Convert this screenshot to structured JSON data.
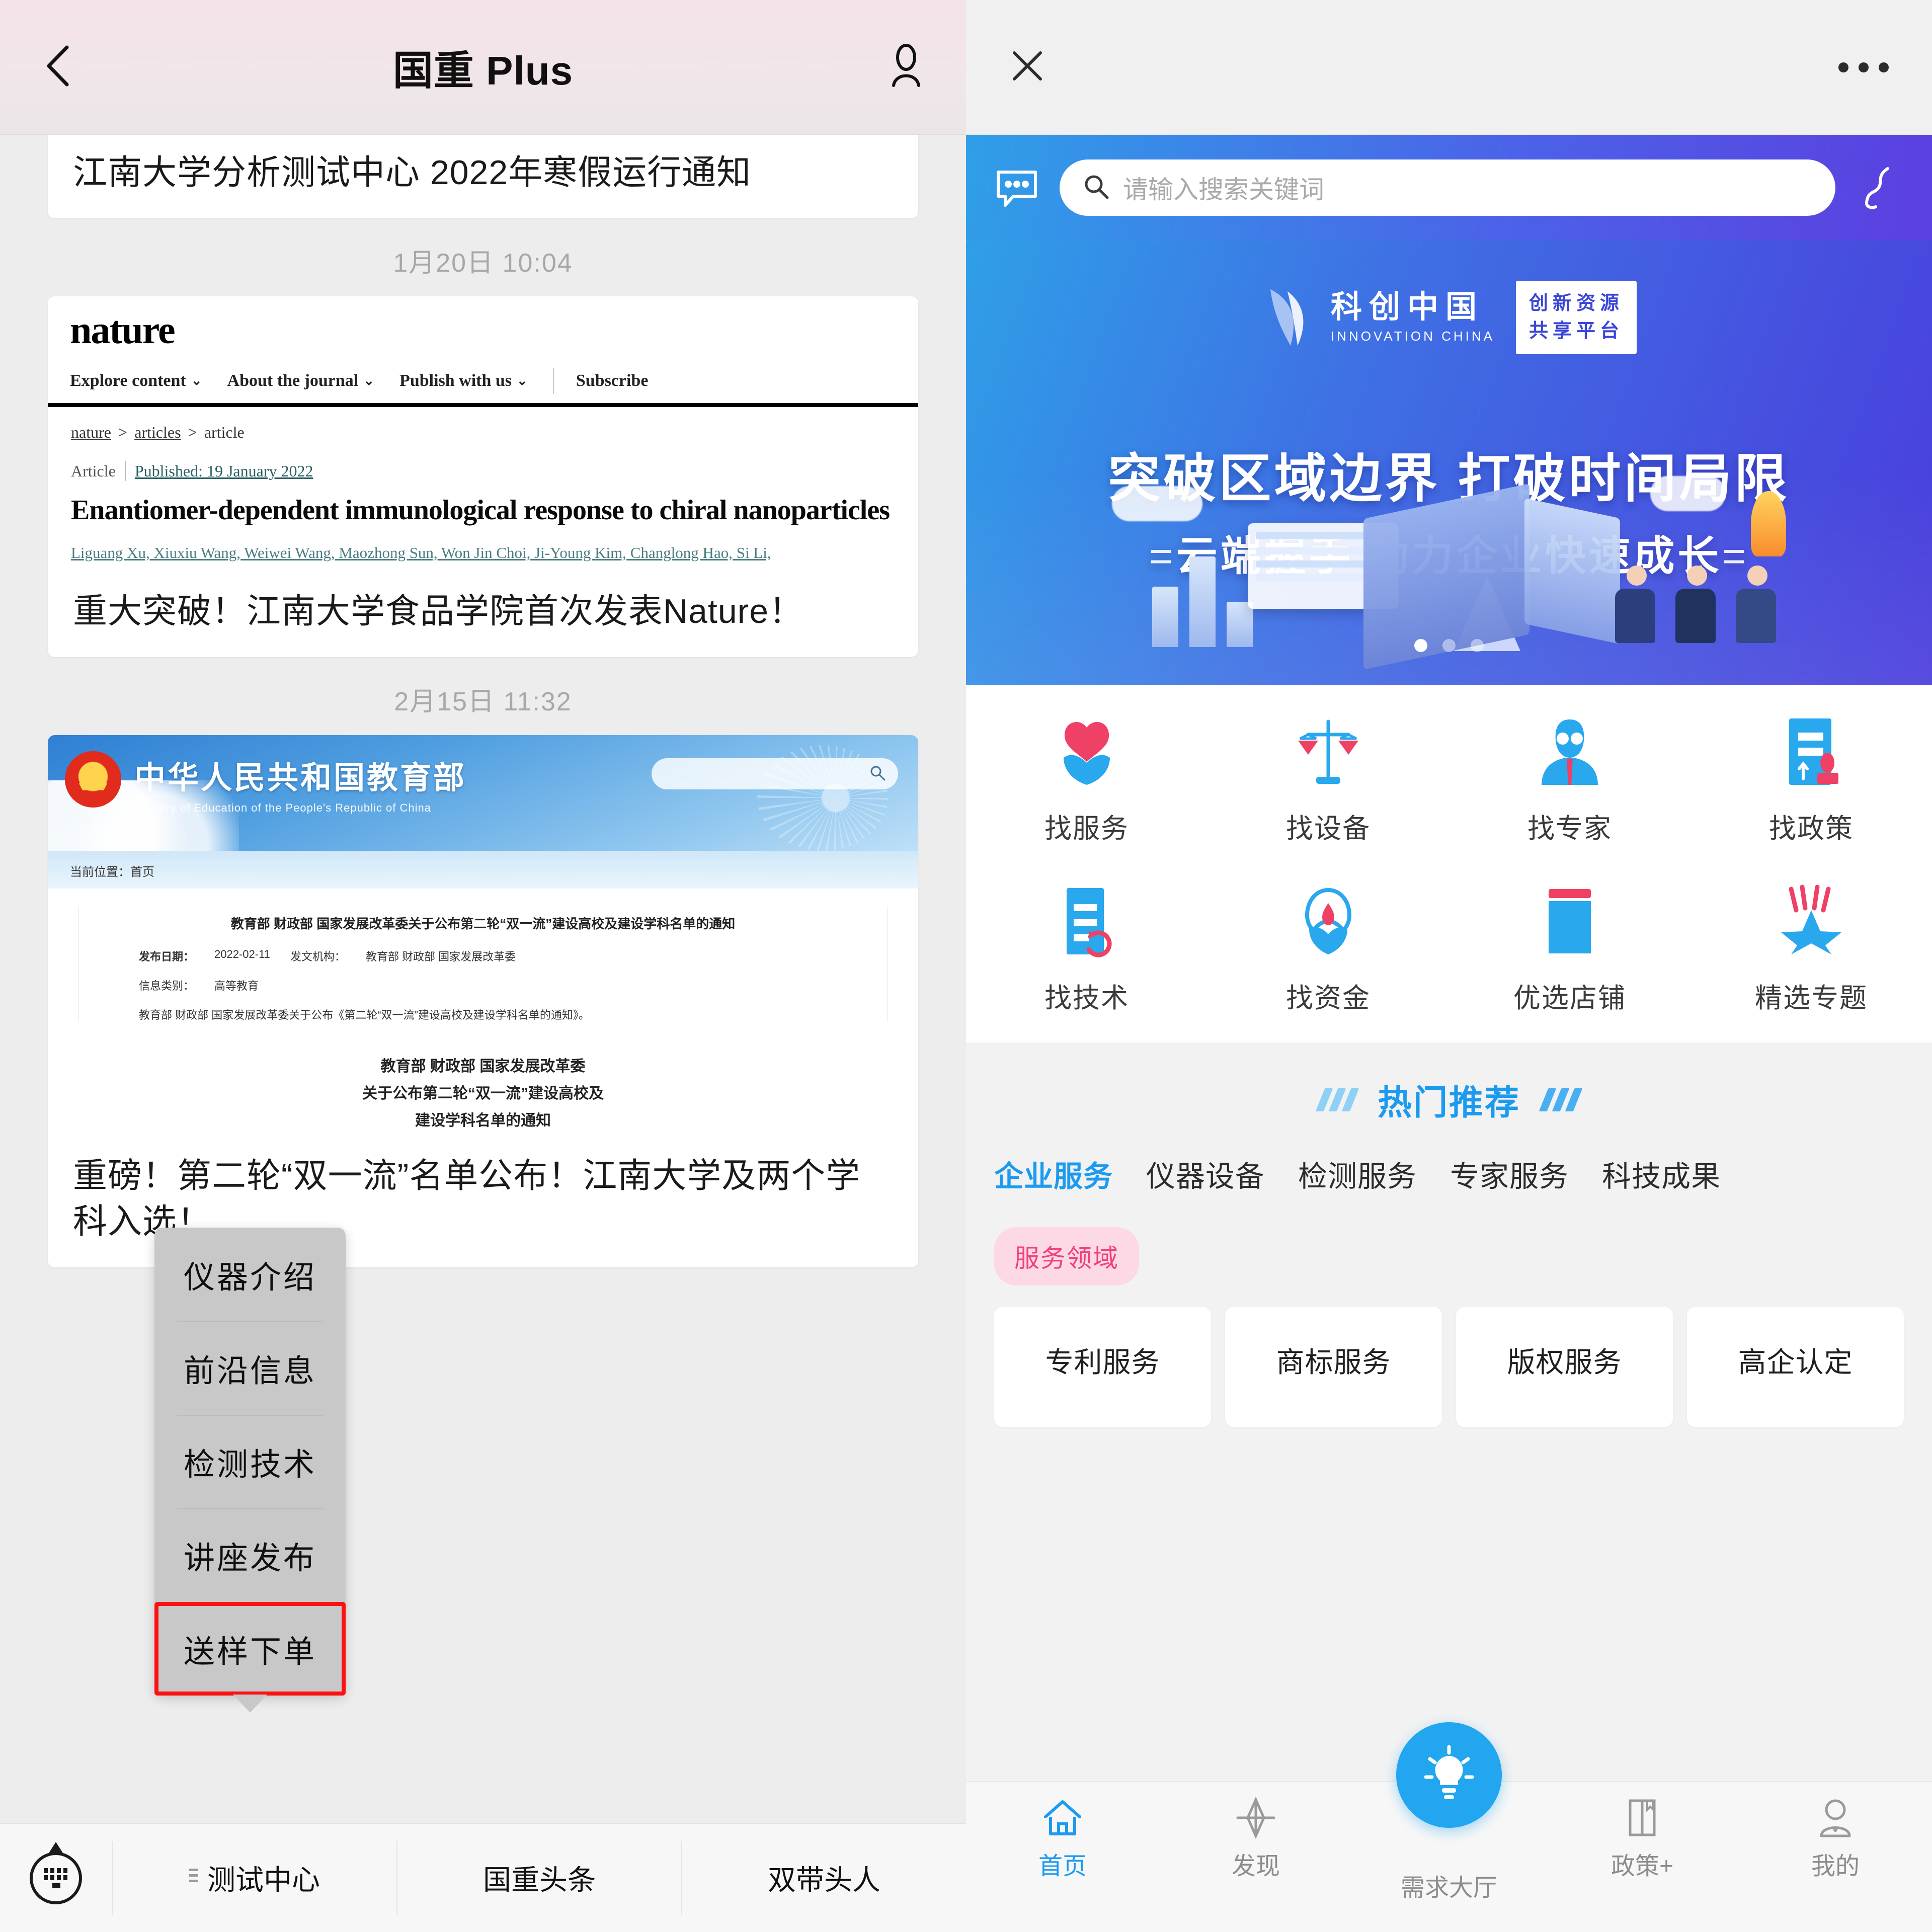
{
  "left": {
    "navbar": {
      "title": "国重 Plus",
      "back_icon": "chevron-left-icon",
      "profile_icon": "person-icon"
    },
    "feed": {
      "card1_title": "江南大学分析测试中心 2022年寒假运行通知",
      "timestamp1": "1月20日 10:04",
      "nature": {
        "logo": "nature",
        "nav": [
          "Explore content",
          "About the journal",
          "Publish with us",
          "Subscribe"
        ],
        "breadcrumb": [
          "nature",
          "articles",
          "article"
        ],
        "meta_kind": "Article",
        "meta_published": "Published: 19 January 2022",
        "article_title": "Enantiomer-dependent immunological response to chiral nanoparticles",
        "authors": "Liguang Xu, Xiuxiu Wang, Weiwei Wang, Maozhong Sun, Won Jin Choi, Ji-Young Kim, Changlong Hao, Si Li,"
      },
      "card2_title": "重大突破！江南大学食品学院首次发表Nature！",
      "timestamp2": "2月15日 11:32",
      "moe": {
        "site_cn": "中华人民共和国教育部",
        "site_en": "Ministry of Education of the People's Republic of China",
        "crumb": "当前位置：首页",
        "doc_head": "教育部 财政部 国家发展改革委关于公布第二轮“双一流”建设高校及建设学科名单的通知",
        "pub_date_label": "发布日期：",
        "pub_date": "2022-02-11",
        "org_label": "发文机构：",
        "org": "教育部 财政部 国家发展改革委",
        "cat_label": "信息类别：",
        "cat": "高等教育",
        "body_line": "教育部 财政部 国家发展改革委关于公布《第二轮“双一流”建设高校及建设学科名单的通知》。",
        "big_title_l1": "教育部 财政部 国家发展改革委",
        "big_title_l2": "关于公布第二轮“双一流”建设高校及",
        "big_title_l3": "建设学科名单的通知"
      },
      "card3_title": "重磅！第二轮“双一流”名单公布！江南大学及两个学科入选！"
    },
    "context_menu": {
      "items": [
        "仪器介绍",
        "前沿信息",
        "检测技术",
        "讲座发布",
        "送样下单"
      ],
      "highlighted": "送样下单",
      "highlight_color": "#fb1111"
    },
    "bottom_bar": {
      "keyboard_icon": "keyboard-toggle-icon",
      "tabs": [
        "测试中心",
        "国重头条",
        "双带头人"
      ]
    }
  },
  "right": {
    "navbar": {
      "close_icon": "close-icon",
      "more_icon": "more-dots-icon"
    },
    "search": {
      "chat_icon": "chat-bubble-icon",
      "search_icon": "search-icon",
      "placeholder": "请输入搜索关键词",
      "phone_icon": "phone-icon"
    },
    "banner": {
      "brand_cn": "科创中国",
      "brand_en": "INNOVATION CHINA",
      "badge_l1": "创新资源",
      "badge_l2": "共享平台",
      "headline1": "突破区域边界  打破时间局限",
      "headline2": "云端握手  助力企业快速成长",
      "dots_total": 3,
      "dots_active": 1
    },
    "grid": [
      {
        "label": "找服务",
        "icon": "heart-in-hand-icon"
      },
      {
        "label": "找设备",
        "icon": "balance-scale-icon"
      },
      {
        "label": "找专家",
        "icon": "expert-person-icon"
      },
      {
        "label": "找政策",
        "icon": "policy-document-icon"
      },
      {
        "label": "找技术",
        "icon": "technology-refresh-icon"
      },
      {
        "label": "找资金",
        "icon": "funding-hand-icon"
      },
      {
        "label": "优选店铺",
        "icon": "shop-icon"
      },
      {
        "label": "精选专题",
        "icon": "star-topic-icon"
      }
    ],
    "hot": {
      "title": "热门推荐",
      "tabs": [
        "企业服务",
        "仪器设备",
        "检测服务",
        "专家服务",
        "科技成果"
      ],
      "active_tab": "企业服务",
      "pill": "服务领域",
      "cards": [
        "专利服务",
        "商标服务",
        "版权服务",
        "高企认定"
      ]
    },
    "tabbar": {
      "items": [
        {
          "label": "首页",
          "icon": "home-icon",
          "active": true
        },
        {
          "label": "发现",
          "icon": "compass-icon",
          "active": false
        },
        {
          "label": "需求大厅",
          "icon": "lightbulb-icon",
          "active": false,
          "center": true
        },
        {
          "label": "政策+",
          "icon": "book-icon",
          "active": false
        },
        {
          "label": "我的",
          "icon": "user-icon",
          "active": false
        }
      ]
    }
  },
  "colors": {
    "accent_blue": "#1c9af0",
    "banner_blue": "#4a3ddc",
    "highlight_red": "#fb1111",
    "pill_pink_bg": "#fcd9e4",
    "pill_pink_fg": "#f2407a"
  }
}
